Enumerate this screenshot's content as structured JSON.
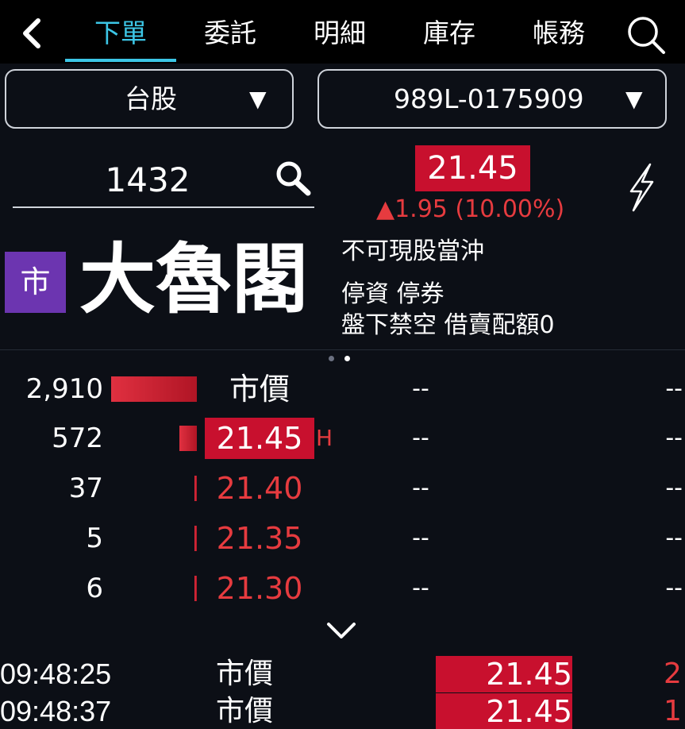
{
  "nav": {
    "back_icon": "chevron-left-icon",
    "tabs": [
      {
        "label": "下單",
        "active": true
      },
      {
        "label": "委託",
        "active": false
      },
      {
        "label": "明細",
        "active": false
      },
      {
        "label": "庫存",
        "active": false
      },
      {
        "label": "帳務",
        "active": false
      }
    ],
    "search_icon": "search-icon"
  },
  "selectors": {
    "market": "台股",
    "account": "989L-0175909",
    "arrow": "▼"
  },
  "stock": {
    "code": "1432",
    "price": "21.45",
    "change": "▲1.95 (10.00%)",
    "market_badge": "市",
    "name": "大魯閣",
    "tags": [
      "不可現股當沖",
      "停資 停券",
      "盤下禁空 借賣配額0"
    ]
  },
  "order_book": {
    "rows": [
      {
        "qty": "2,910",
        "price": "市價",
        "mark": "",
        "left": "--",
        "right": "--",
        "style": "plain",
        "bar_fraction": 1.0
      },
      {
        "qty": "572",
        "price": "21.45",
        "mark": "H",
        "left": "--",
        "right": "--",
        "style": "highlight",
        "bar_fraction": 0.2
      },
      {
        "qty": "37",
        "price": "21.40",
        "mark": "",
        "left": "--",
        "right": "--",
        "style": "red",
        "bar_fraction": 0.013
      },
      {
        "qty": "5",
        "price": "21.35",
        "mark": "",
        "left": "--",
        "right": "--",
        "style": "red",
        "bar_fraction": 0.002
      },
      {
        "qty": "6",
        "price": "21.30",
        "mark": "",
        "left": "--",
        "right": "--",
        "style": "red",
        "bar_fraction": 0.002
      }
    ]
  },
  "trades": [
    {
      "time": "09:48:25",
      "type": "市價",
      "price": "21.45",
      "volume": "2"
    },
    {
      "time": "09:48:37",
      "type": "市價",
      "price": "21.45",
      "volume": "1"
    }
  ],
  "colors": {
    "accent": "#3cc6e6",
    "up_red": "#e63b3f",
    "highlight_red": "#c8102e",
    "badge_purple": "#6c35b0",
    "background": "#0c0f16"
  }
}
